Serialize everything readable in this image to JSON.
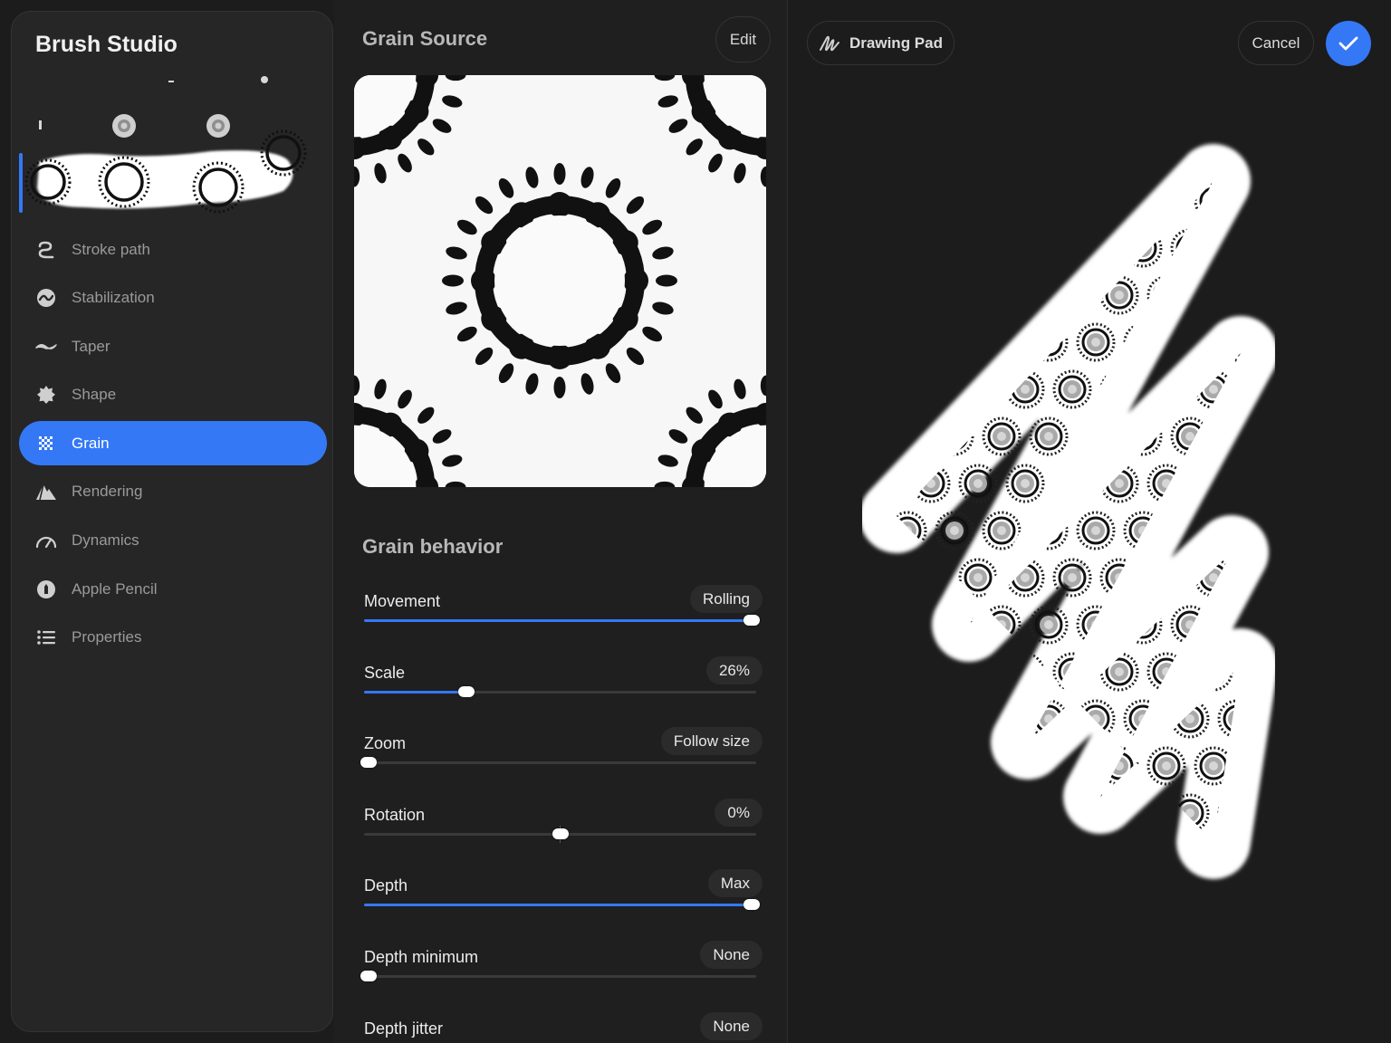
{
  "sidebar": {
    "title": "Brush Studio",
    "items": [
      {
        "label": "Stroke path",
        "icon": "stroke-path-icon",
        "active": false
      },
      {
        "label": "Stabilization",
        "icon": "stabilization-icon",
        "active": false
      },
      {
        "label": "Taper",
        "icon": "taper-icon",
        "active": false
      },
      {
        "label": "Shape",
        "icon": "shape-icon",
        "active": false
      },
      {
        "label": "Grain",
        "icon": "grain-icon",
        "active": true
      },
      {
        "label": "Rendering",
        "icon": "rendering-icon",
        "active": false
      },
      {
        "label": "Dynamics",
        "icon": "dynamics-icon",
        "active": false
      },
      {
        "label": "Apple Pencil",
        "icon": "apple-pencil-icon",
        "active": false
      },
      {
        "label": "Properties",
        "icon": "properties-icon",
        "active": false
      }
    ]
  },
  "settings": {
    "grain_source_title": "Grain Source",
    "edit_label": "Edit",
    "behavior_title": "Grain behavior",
    "sliders": [
      {
        "label": "Movement",
        "value": "Rolling",
        "level": 1.0,
        "fill": true
      },
      {
        "label": "Scale",
        "value": "26%",
        "level": 0.26,
        "fill": true
      },
      {
        "label": "Zoom",
        "value": "Follow size",
        "level": 0.0,
        "fill": true
      },
      {
        "label": "Rotation",
        "value": "0%",
        "level": 0.5,
        "fill": false
      },
      {
        "label": "Depth",
        "value": "Max",
        "level": 1.0,
        "fill": true
      },
      {
        "label": "Depth minimum",
        "value": "None",
        "level": 0.0,
        "fill": true
      },
      {
        "label": "Depth jitter",
        "value": "None",
        "level": 0.0,
        "fill": true
      }
    ]
  },
  "pad": {
    "drawing_pad_label": "Drawing Pad",
    "cancel_label": "Cancel"
  },
  "colors": {
    "accent": "#3478f6",
    "panel": "#262626",
    "background": "#1c1c1c"
  }
}
